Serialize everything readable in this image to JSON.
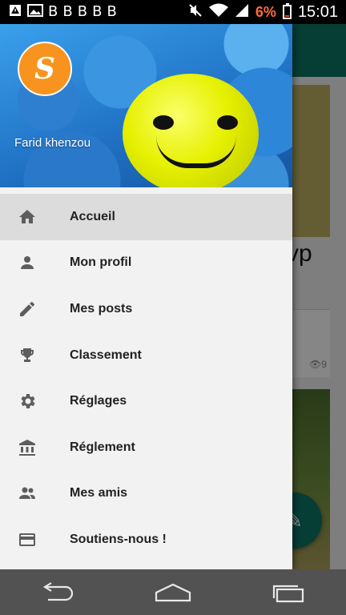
{
  "status_bar": {
    "battery_percent": "6%",
    "time": "15:01",
    "left_icons": [
      "alert-icon",
      "image-icon",
      "b-notification-icon",
      "b-notification-icon",
      "b-notification-icon",
      "b-notification-icon",
      "b-notification-icon"
    ],
    "right_icons": [
      "mute-icon",
      "wifi-icon",
      "signal-icon",
      "battery-icon"
    ],
    "battery_color": "#ff6a3d"
  },
  "drawer": {
    "user_name": "Farid khenzou",
    "logo_letter": "S",
    "items": [
      {
        "label": "Accueil",
        "icon": "home-icon",
        "active": true
      },
      {
        "label": "Mon profil",
        "icon": "person-icon",
        "active": false
      },
      {
        "label": "Mes posts",
        "icon": "pencil-icon",
        "active": false
      },
      {
        "label": "Classement",
        "icon": "trophy-icon",
        "active": false
      },
      {
        "label": "Réglages",
        "icon": "gear-icon",
        "active": false
      },
      {
        "label": "Réglement",
        "icon": "bank-icon",
        "active": false
      },
      {
        "label": "Mes amis",
        "icon": "group-icon",
        "active": false
      },
      {
        "label": "Soutiens-nous !",
        "icon": "credit-card-icon",
        "active": false
      }
    ]
  },
  "background": {
    "card_title_fragment": "vp",
    "view_count": "9",
    "appbar_color": "#0b6f60"
  },
  "nav_bar": {
    "buttons": [
      "back-icon",
      "home-icon",
      "recents-icon"
    ]
  }
}
